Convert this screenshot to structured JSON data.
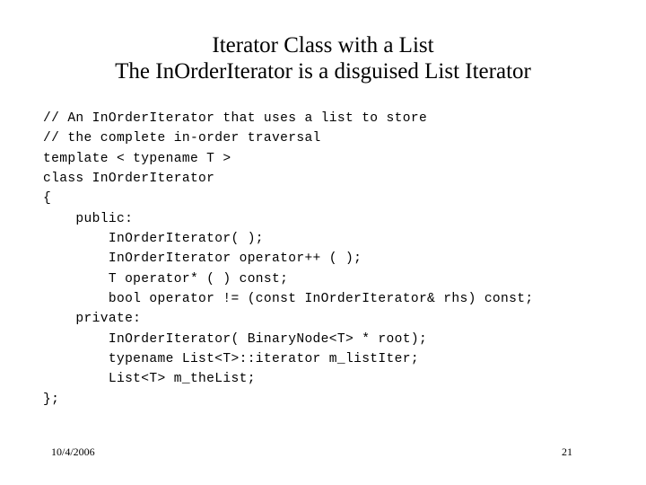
{
  "slide": {
    "background_color": "#ffffff",
    "text_color": "#000000",
    "title": {
      "line1": "Iterator Class with a List",
      "line2": "The InOrderIterator is a disguised List Iterator"
    },
    "code": {
      "lines": [
        "// An InOrderIterator that uses a list to store",
        "// the complete in-order traversal",
        "template < typename T >",
        "class InOrderIterator",
        "{",
        "    public:",
        "        InOrderIterator( );",
        "        InOrderIterator operator++ ( );",
        "        T operator* ( ) const;",
        "        bool operator != (const InOrderIterator& rhs) const;",
        "    private:",
        "        InOrderIterator( BinaryNode<T> * root);",
        "        typename List<T>::iterator m_listIter;",
        "        List<T> m_theList;",
        "};"
      ]
    },
    "footer": {
      "date": "10/4/2006",
      "page_number": "21"
    }
  }
}
